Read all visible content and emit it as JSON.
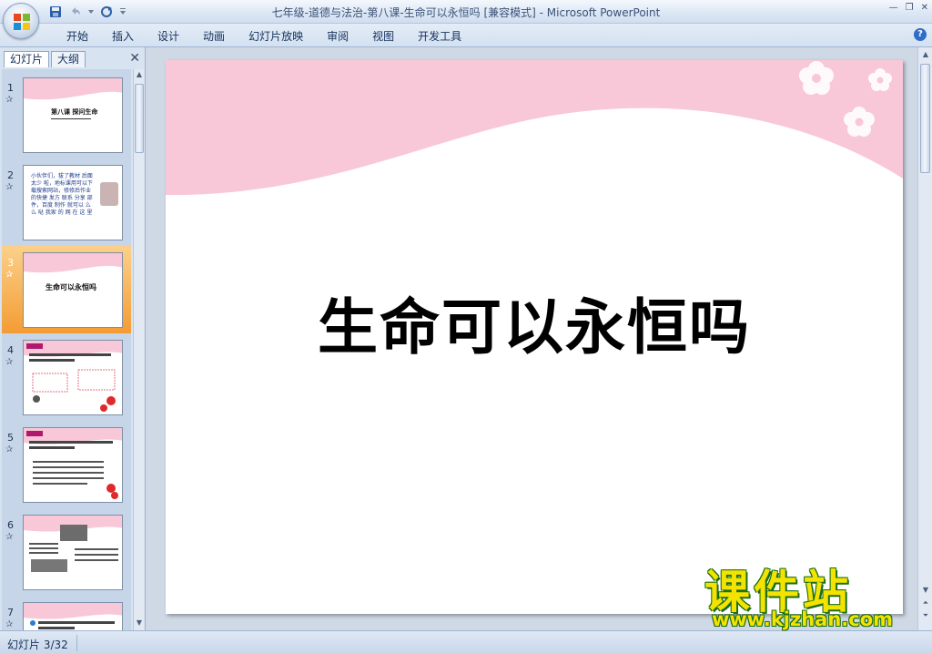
{
  "window": {
    "title": "七年级-道德与法治-第八课-生命可以永恒吗 [兼容模式] - Microsoft PowerPoint",
    "controls": [
      "—",
      "❐",
      "✕"
    ]
  },
  "ribbon": {
    "tabs": [
      "开始",
      "插入",
      "设计",
      "动画",
      "幻灯片放映",
      "审阅",
      "视图",
      "开发工具"
    ],
    "help": "?"
  },
  "left_pane": {
    "tabs": [
      "幻灯片",
      "大纲"
    ],
    "close": "✕",
    "thumbnails": [
      {
        "number": "1",
        "text": "第八课 探问生命"
      },
      {
        "number": "2",
        "text": "小伙伴们，拔了教材 后面太少 啦，地标课用可以下载搜索网站，修修后作业 的快捷 发方 联系 分享 部件，百度 制作 就可以 么 么 哒  我家 的 网 在 这 里"
      },
      {
        "number": "3",
        "text": "生命可以永恒吗"
      },
      {
        "number": "4",
        "text": ""
      },
      {
        "number": "5",
        "text": ""
      },
      {
        "number": "6",
        "text": ""
      },
      {
        "number": "7",
        "text": ""
      }
    ]
  },
  "slide": {
    "title": "生命可以永恒吗"
  },
  "status": {
    "slide_indicator": "幻灯片 3/32"
  },
  "watermark": {
    "big": "课件站",
    "small": "www.kjzhan.com"
  },
  "colors": {
    "accent_pink": "#f8c8d8",
    "selected_thumb": "#f39c33",
    "ribbon_blue": "#d4e1f1"
  }
}
